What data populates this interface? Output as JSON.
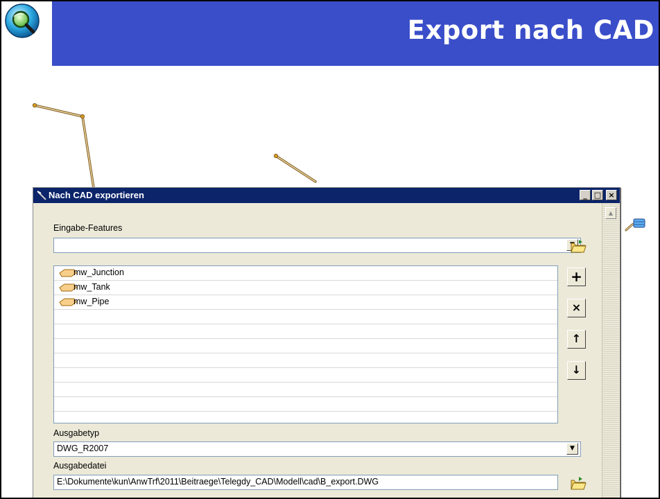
{
  "slide": {
    "title": "Export nach CAD"
  },
  "dialog": {
    "title": "Nach CAD exportieren",
    "window_buttons": {
      "minimize": "_",
      "maximize": "□",
      "close": "×"
    },
    "input_features_label": "Eingabe-Features",
    "input_features_value": "",
    "features": [
      {
        "label": "mw_Junction",
        "icon": "feature-layer-icon"
      },
      {
        "label": "mw_Tank",
        "icon": "feature-layer-icon"
      },
      {
        "label": "mw_Pipe",
        "icon": "feature-layer-icon"
      }
    ],
    "tool_buttons": {
      "add": "+",
      "remove": "×",
      "move_up": "↑",
      "move_down": "↓"
    },
    "output_type_label": "Ausgabetyp",
    "output_type_value": "DWG_R2007",
    "output_file_label": "Ausgabedatei",
    "output_file_value": "E:\\Dokumente\\kun\\AnwTrf\\2011\\Beitraege\\Telegdy_CAD\\Modell\\cad\\B_export.DWG"
  },
  "colors": {
    "title_band": "#3a4ec9",
    "dialog_titlebar": "#0b246a",
    "dialog_body": "#ece9d8",
    "map_line": "#d2a04a"
  }
}
